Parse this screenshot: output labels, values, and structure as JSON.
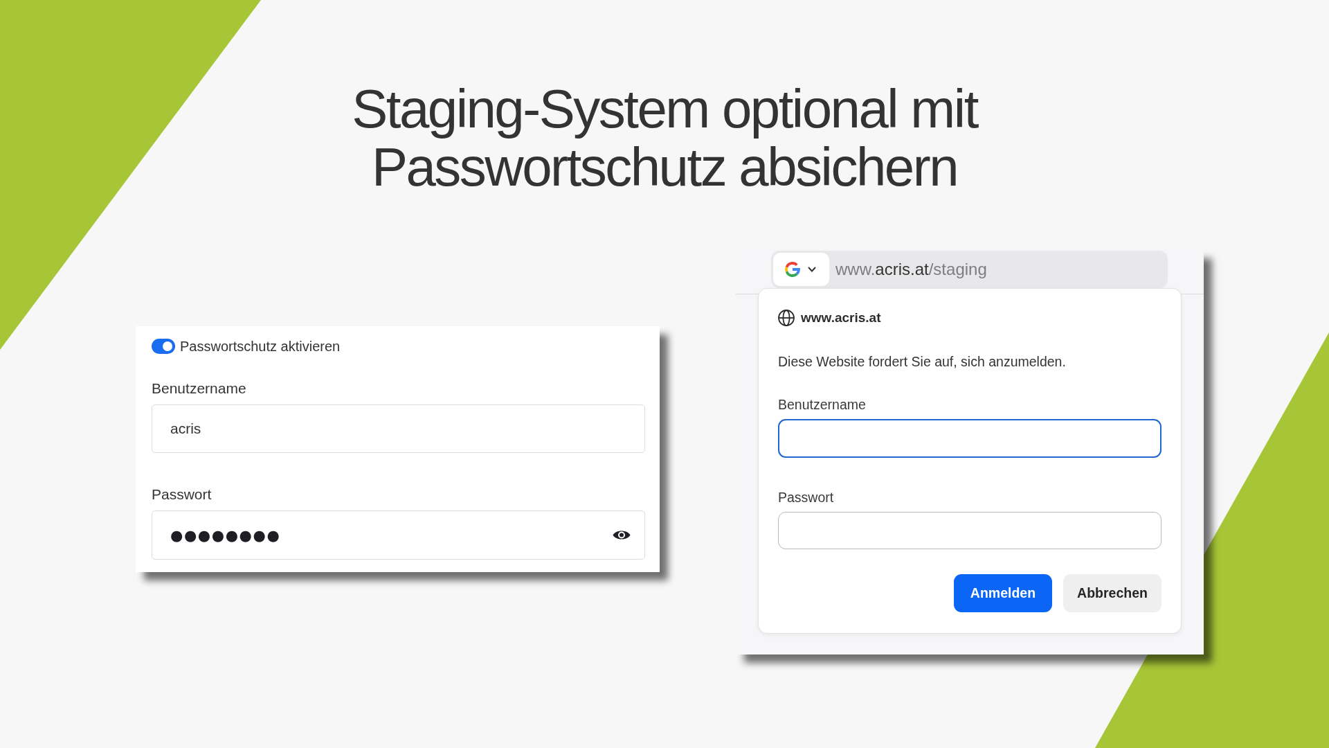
{
  "title": "Staging-System optional mit Passwortschutz absichern",
  "settings_panel": {
    "protection_toggle": {
      "label": "Passwortschutz aktivieren",
      "on": true
    },
    "fields": [
      {
        "kind": "text",
        "label": "Benutzername",
        "value": "acris"
      },
      {
        "kind": "password",
        "label": "Passwort",
        "value": "●●●●●●●●"
      }
    ]
  },
  "browser": {
    "address_bar": {
      "url_parts": [
        {
          "text": "www.",
          "emphasized": false
        },
        {
          "text": "acris.at",
          "emphasized": true
        },
        {
          "text": "/staging",
          "emphasized": false
        }
      ]
    },
    "login_dialog": {
      "site": "www.acris.at",
      "message": "Diese Website fordert Sie auf, sich anzumelden.",
      "fields": [
        {
          "label": "Benutzername",
          "focused": true
        },
        {
          "label": "Passwort",
          "focused": false
        }
      ],
      "buttons": [
        {
          "label": "Anmelden",
          "primary": true
        },
        {
          "label": "Abbrechen",
          "primary": false
        }
      ]
    }
  }
}
